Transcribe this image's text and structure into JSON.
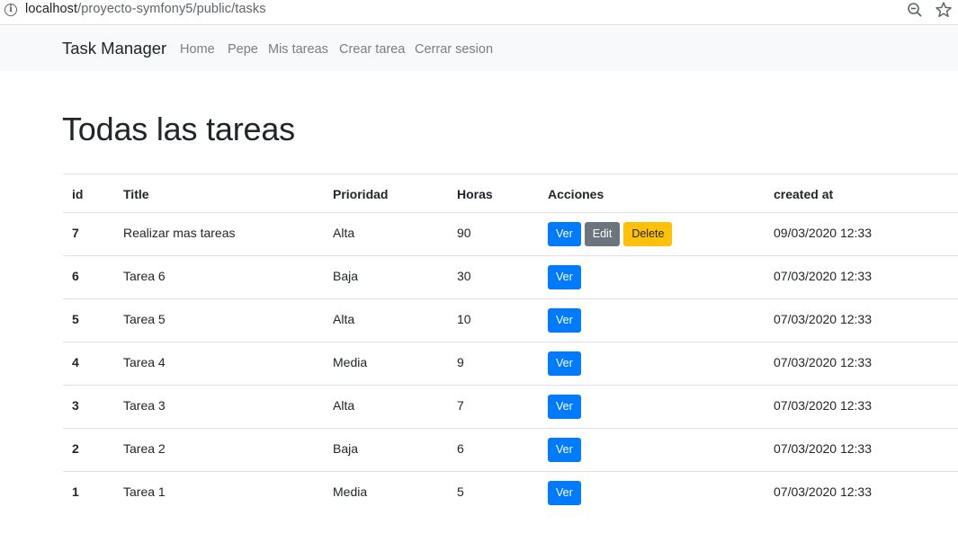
{
  "browser": {
    "url_host": "localhost",
    "url_path": "/proyecto-symfony5/public/tasks"
  },
  "navbar": {
    "brand": "Task Manager",
    "links": [
      "Home",
      "Pepe",
      "Mis tareas",
      "Crear tarea",
      "Cerrar sesion"
    ]
  },
  "page": {
    "title": "Todas las tareas"
  },
  "table": {
    "headers": [
      "id",
      "Title",
      "Prioridad",
      "Horas",
      "Acciones",
      "created at"
    ],
    "rows": [
      {
        "id": "7",
        "title": "Realizar mas tareas",
        "prioridad": "Alta",
        "horas": "90",
        "created_at": "09/03/2020 12:33"
      },
      {
        "id": "6",
        "title": "Tarea 6",
        "prioridad": "Baja",
        "horas": "30",
        "created_at": "07/03/2020 12:33"
      },
      {
        "id": "5",
        "title": "Tarea 5",
        "prioridad": "Alta",
        "horas": "10",
        "created_at": "07/03/2020 12:33"
      },
      {
        "id": "4",
        "title": "Tarea 4",
        "prioridad": "Media",
        "horas": "9",
        "created_at": "07/03/2020 12:33"
      },
      {
        "id": "3",
        "title": "Tarea 3",
        "prioridad": "Alta",
        "horas": "7",
        "created_at": "07/03/2020 12:33"
      },
      {
        "id": "2",
        "title": "Tarea 2",
        "prioridad": "Baja",
        "horas": "6",
        "created_at": "07/03/2020 12:33"
      },
      {
        "id": "1",
        "title": "Tarea 1",
        "prioridad": "Media",
        "horas": "5",
        "created_at": "07/03/2020 12:33"
      }
    ],
    "actions": {
      "ver": "Ver",
      "edit": "Edit",
      "delete": "Delete"
    }
  },
  "colors": {
    "primary": "#007bff",
    "secondary": "#6c757d",
    "warning": "#ffc107",
    "navbar_bg": "#f8f9fa"
  },
  "icons": [
    "info-icon",
    "zoom-out-icon",
    "star-icon"
  ]
}
